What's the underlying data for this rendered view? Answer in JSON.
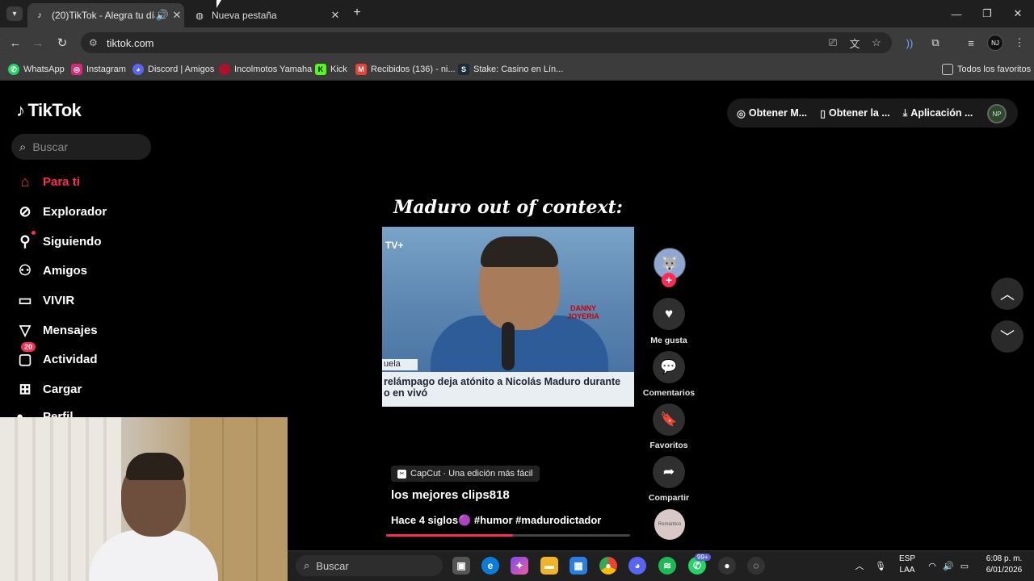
{
  "browser": {
    "tabs": [
      {
        "title": "(20)TikTok - Alegra tu día",
        "icon": "tiktok-icon"
      },
      {
        "title": "Nueva pestaña",
        "icon": "globe-icon"
      }
    ],
    "url": "tiktok.com",
    "bookmarks": [
      {
        "label": "WhatsApp",
        "icon": "whatsapp-icon",
        "color": "#25d366"
      },
      {
        "label": "Instagram",
        "icon": "instagram-icon",
        "color": "#d62976"
      },
      {
        "label": "Discord | Amigos",
        "icon": "discord-icon",
        "color": "#5865f2"
      },
      {
        "label": "Incolmotos Yamaha",
        "icon": "yamaha-icon",
        "color": "#b0102a"
      },
      {
        "label": "Kick",
        "icon": "kick-icon",
        "color": "#53fc18"
      },
      {
        "label": "Recibidos (136) - ni...",
        "icon": "gmail-icon",
        "color": "#ea4335"
      },
      {
        "label": "Stake: Casino en Lín...",
        "icon": "stake-icon",
        "color": "#1a2c38"
      }
    ],
    "all_bookmarks_label": "Todos los favoritos"
  },
  "tiktok": {
    "logo": "TikTok",
    "search_placeholder": "Buscar",
    "nav": [
      {
        "label": "Para ti",
        "icon": "home-icon",
        "active": true
      },
      {
        "label": "Explorador",
        "icon": "compass-icon"
      },
      {
        "label": "Siguiendo",
        "icon": "following-icon"
      },
      {
        "label": "Amigos",
        "icon": "friends-icon"
      },
      {
        "label": "VIVIR",
        "icon": "live-icon"
      },
      {
        "label": "Mensajes",
        "icon": "messages-icon"
      },
      {
        "label": "Actividad",
        "icon": "activity-icon",
        "badge": "20"
      },
      {
        "label": "Cargar",
        "icon": "upload-icon"
      },
      {
        "label": "Perfil",
        "icon": "profile-icon"
      }
    ],
    "top_actions": [
      {
        "label": "Obtener M...",
        "icon": "coin-icon"
      },
      {
        "label": "Obtener la ...",
        "icon": "phone-icon"
      },
      {
        "label": "Aplicación ...",
        "icon": "download-icon"
      }
    ],
    "profile_initials": "NP",
    "video": {
      "overlay_title": "Maduro out of context:",
      "caption_line1": "relámpago deja atónito a Nicolás Maduro durante",
      "caption_line2": "o en vivó",
      "caption_side": "uela",
      "channel_tag": "TV+",
      "sponsor_logo": "DANNY JOYERIA",
      "capcut_label": "CapCut · Una edición más fácil",
      "author": "los mejores clips818",
      "description": "Hace 4 siglos🟣 #humor #madurodictador",
      "progress": 0.52
    },
    "actions": [
      {
        "label": "Me gusta",
        "icon": "heart-icon"
      },
      {
        "label": "Comentarios",
        "icon": "comment-icon"
      },
      {
        "label": "Favoritos",
        "icon": "bookmark-icon"
      },
      {
        "label": "Compartir",
        "icon": "share-icon"
      }
    ],
    "music_disc_label": "Romántico",
    "accent_color": "#fe2c55"
  },
  "taskbar": {
    "search_placeholder": "Buscar",
    "language": "ESP",
    "language_sub": "LAA",
    "time": "6:08 p. m.",
    "date": "6/01/2026",
    "whatsapp_badge": "99+"
  }
}
